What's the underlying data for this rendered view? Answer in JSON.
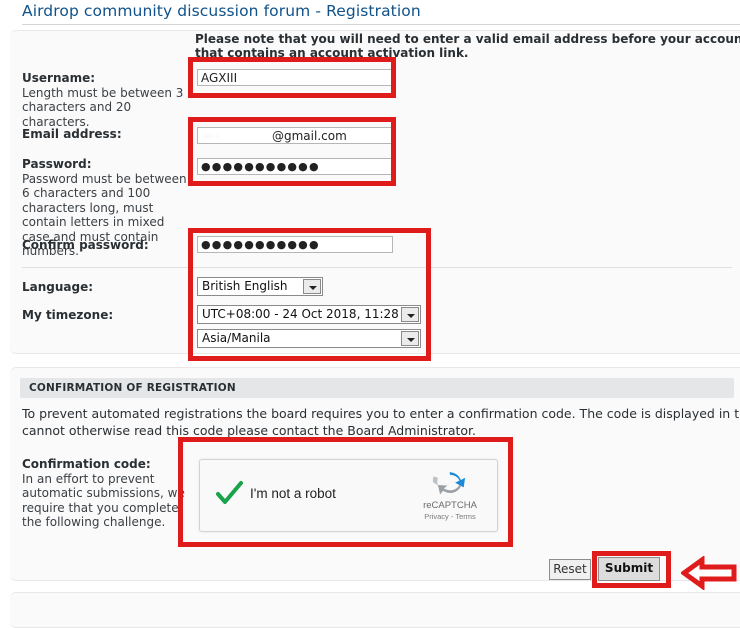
{
  "header": {
    "title": "Airdrop community discussion forum - Registration"
  },
  "notice": {
    "line1": "Please note that you will need to enter a valid email address before your account is",
    "line2": "that contains an account activation link."
  },
  "form": {
    "fields": [
      {
        "key": "username",
        "label": "Username:",
        "desc": "Length must be between 3 characters and 20 characters.",
        "value": "AGXIII"
      },
      {
        "key": "email",
        "label": "Email address:",
        "desc": "",
        "value_masked": "···      ·",
        "value_domain": "@gmail.com"
      },
      {
        "key": "password",
        "label": "Password:",
        "desc": "Password must be between 6 characters and 100 characters long, must contain letters in mixed case and must contain numbers.",
        "value": "●●●●●●●●●●●"
      },
      {
        "key": "confirm_password",
        "label": "Confirm password:",
        "desc": "",
        "value": "●●●●●●●●●●●"
      },
      {
        "key": "language",
        "label": "Language:",
        "desc": "",
        "value": "British English"
      },
      {
        "key": "timezone",
        "label": "My timezone:",
        "desc": "",
        "value_offset": "UTC+08:00 - 24 Oct 2018, 11:28",
        "value_name": "Asia/Manila"
      }
    ]
  },
  "confirmation": {
    "section_title": "CONFIRMATION OF REGISTRATION",
    "intro_line1": "To prevent automated registrations the board requires you to enter a confirmation code. The code is displayed in t",
    "intro_line2": "cannot otherwise read this code please contact the Board Administrator.",
    "code_label": "Confirmation code:",
    "code_desc": "In an effort to prevent automatic submissions, we require that you complete the following challenge.",
    "recaptcha": {
      "checkbox_label": "I'm not a robot",
      "brand": "reCAPTCHA",
      "legal": "Privacy - Terms",
      "checked": true
    }
  },
  "buttons": {
    "reset": "Reset",
    "submit": "Submit"
  },
  "annotations": {
    "highlight_color": "#e01b1b",
    "arrow_direction": "left"
  }
}
